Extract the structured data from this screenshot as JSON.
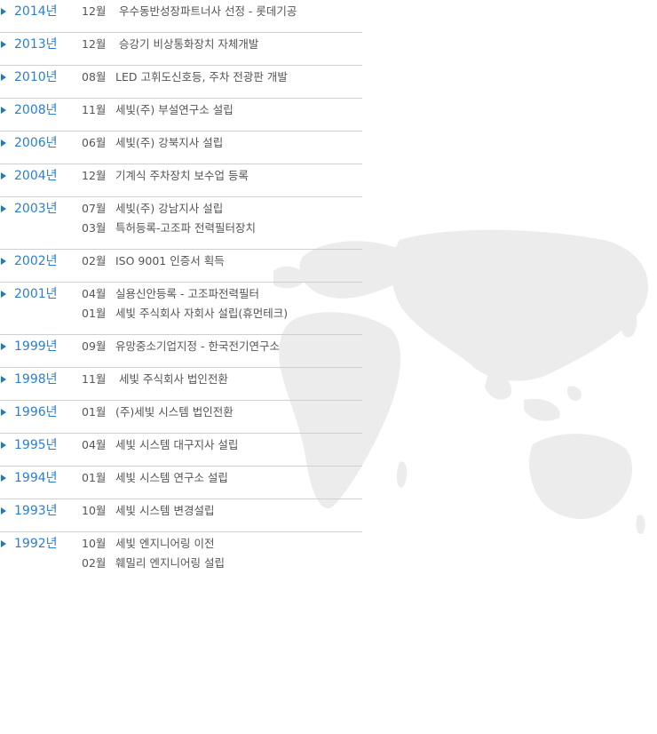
{
  "timeline": [
    {
      "year": "2014년",
      "items": [
        {
          "month": "12월",
          "text": " 우수동반성장파트너사 선정 - 롯데기공"
        }
      ]
    },
    {
      "year": "2013년",
      "items": [
        {
          "month": "12월",
          "text": " 승강기 비상통화장치 자체개발"
        }
      ]
    },
    {
      "year": "2010년",
      "items": [
        {
          "month": "08월",
          "text": "LED 고휘도신호등, 주차 전광판 개발"
        }
      ]
    },
    {
      "year": "2008년",
      "items": [
        {
          "month": "11월",
          "text": "세빛(주) 부설연구소 설립"
        }
      ]
    },
    {
      "year": "2006년",
      "items": [
        {
          "month": "06월",
          "text": "세빛(주) 강북지사 설립"
        }
      ]
    },
    {
      "year": "2004년",
      "items": [
        {
          "month": "12월",
          "text": "기계식 주차장치 보수업 등록"
        }
      ]
    },
    {
      "year": "2003년",
      "items": [
        {
          "month": "07월",
          "text": "세빛(주) 강남지사 설립"
        },
        {
          "month": "03월",
          "text": "특허등록-고조파 전력필터장치"
        }
      ]
    },
    {
      "year": "2002년",
      "items": [
        {
          "month": "02월",
          "text": "ISO 9001 인증서 획득"
        }
      ]
    },
    {
      "year": "2001년",
      "items": [
        {
          "month": "04월",
          "text": "실용신안등록 - 고조파전력필터"
        },
        {
          "month": "01월",
          "text": "세빛 주식회사 자회사 설립(휴먼테크)"
        }
      ]
    },
    {
      "year": "1999년",
      "items": [
        {
          "month": "09월",
          "text": "유망중소기업지정 - 한국전기연구소"
        }
      ]
    },
    {
      "year": "1998년",
      "items": [
        {
          "month": "11월",
          "text": " 세빛 주식회사 법인전환"
        }
      ]
    },
    {
      "year": "1996년",
      "items": [
        {
          "month": "01월",
          "text": "(주)세빛 시스템 법인전환"
        }
      ]
    },
    {
      "year": "1995년",
      "items": [
        {
          "month": "04월",
          "text": "세빛 시스템 대구지사 설립"
        }
      ]
    },
    {
      "year": "1994년",
      "items": [
        {
          "month": "01월",
          "text": "세빛 시스템 연구소 설립"
        }
      ]
    },
    {
      "year": "1993년",
      "items": [
        {
          "month": "10월",
          "text": "세빛 시스템 변경설립"
        }
      ]
    },
    {
      "year": "1992년",
      "items": [
        {
          "month": "10월",
          "text": "세빛 엔지니어링 이전"
        },
        {
          "month": "02월",
          "text": "훼밀리 엔지니어링 설립"
        }
      ]
    }
  ],
  "colors": {
    "year": "#2a7fd0",
    "arrow": "#1f78c8",
    "text": "#555555",
    "divider": "#cfcfcf",
    "map": "#ececec"
  },
  "icons": {
    "year_marker": "right-triangle-icon",
    "background": "world-map-image"
  }
}
